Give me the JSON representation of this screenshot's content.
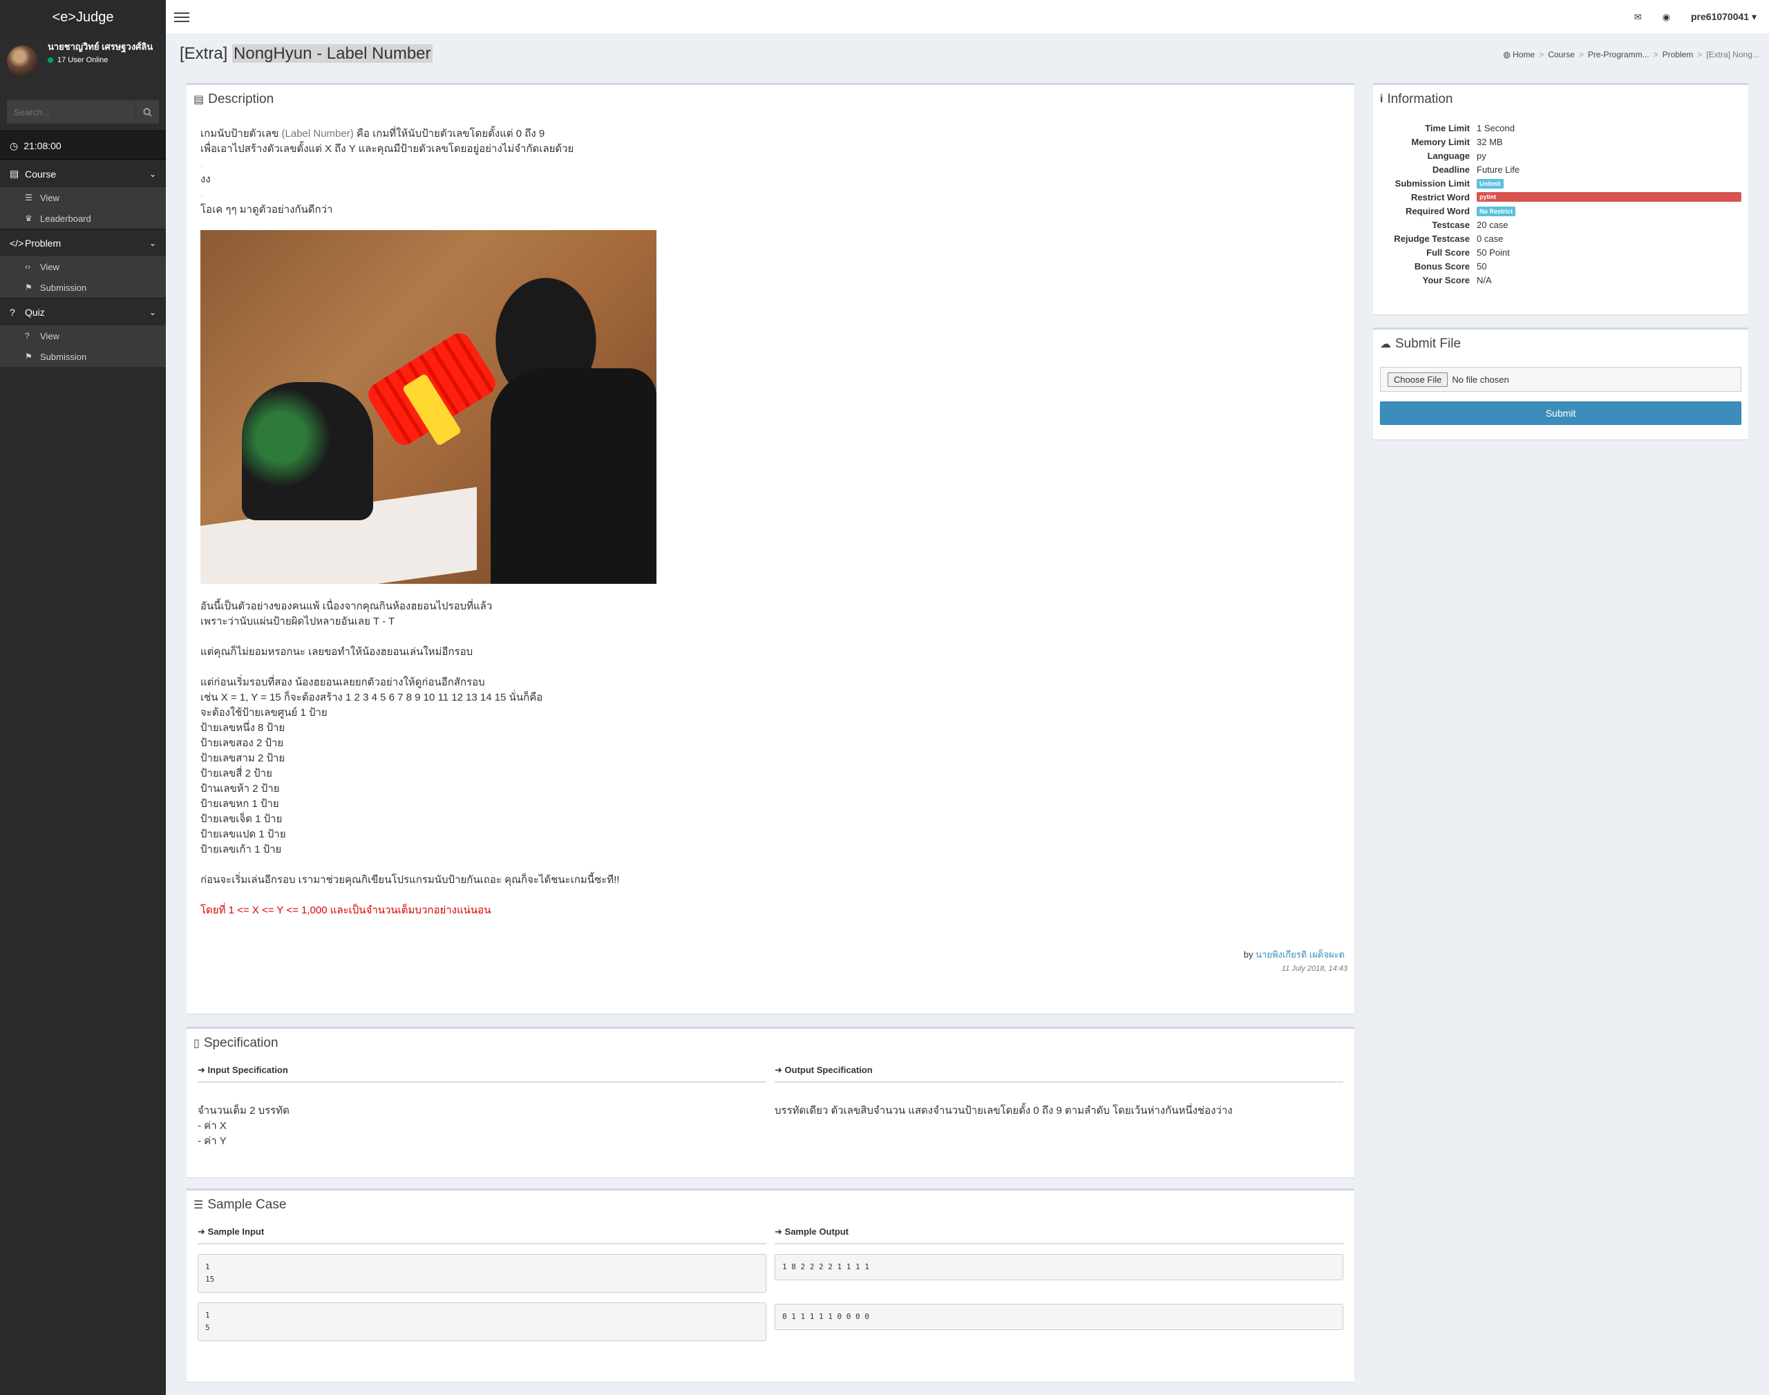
{
  "app": {
    "logo": "<e>Judge"
  },
  "user": {
    "name": "นายชาญวิทย์ เศรษฐวงศ์ลิน",
    "online": "17 User Online",
    "username": "pre61070041"
  },
  "search": {
    "placeholder": "Search..."
  },
  "clock": "21:08:00",
  "sidebar": {
    "sections": [
      {
        "label": "Course",
        "items": [
          {
            "label": "View"
          },
          {
            "label": "Leaderboard"
          }
        ]
      },
      {
        "label": "Problem",
        "items": [
          {
            "label": "View"
          },
          {
            "label": "Submission"
          }
        ]
      },
      {
        "label": "Quiz",
        "items": [
          {
            "label": "View"
          },
          {
            "label": "Submission"
          }
        ]
      }
    ]
  },
  "page": {
    "title_prefix": "[Extra] ",
    "title_main": "NongHyun - Label Number"
  },
  "breadcrumb": [
    "Home",
    "Course",
    "Pre-Programm...",
    "Problem",
    "[Extra] Nong..."
  ],
  "description": {
    "heading": "Description",
    "line1_a": "เกมนับป้ายตัวเลข ",
    "line1_b": "(Label Number)",
    "line1_c": " คือ เกมที่ให้นับป้ายตัวเลขโดยตั้งแต่ 0 ถึง 9",
    "line2": "เพื่อเอาไปสร้างตัวเลขตั้งแต่ X ถึง Y และคุณมีป้ายตัวเลขโดยอยู่อย่างไม่จำกัดเลยด้วย",
    "dot": ".",
    "ngong": "งง",
    "okay": "โอเค ๆๆ มาดูตัวอย่างกันดีกว่า",
    "para1": [
      "อันนี้เป็นตัวอย่างของคนแพ้ เนื่องจากคุณกินห้องฮยอนไปรอบที่แล้ว",
      "เพราะว่านับแผ่นป้ายผิดไปหลายอันเลย  T -  T"
    ],
    "para2": "แต่คุณก็ไม่ยอมหรอกนะ เลยขอทำให้น้องฮยอนเล่นใหม่อีกรอบ",
    "para3": [
      "แต่ก่อนเริ่มรอบที่สอง น้องฮยอนเลยยกตัวอย่างให้ดูก่อนอีกสักรอบ",
      "เช่น X = 1, Y = 15 ก็จะต้องสร้าง 1 2 3 4 5 6 7 8 9 10 11 12 13 14 15 นั่นก็คือ",
      "จะต้องใช้ป้ายเลขศูนย์ 1 ป้าย",
      "ป้ายเลขหนึ่ง 8 ป้าย",
      "ป้ายเลขสอง 2 ป้าย",
      "ป้ายเลขสาม 2 ป้าย",
      "ป้ายเลขสี่ 2 ป้าย",
      "ป้านเลขห้า 2 ป้าย",
      "ป้ายเลขหก 1 ป้าย",
      "ป้ายเลขเจ็ด 1 ป้าย",
      "ป้ายเลขแปด 1 ป้าย",
      "ป้ายเลขเก้า 1 ป้าย"
    ],
    "para4": "ก่อนจะเริ่มเล่นอีกรอบ เรามาช่วยคุณกิเขียนโปรแกรมนับป้ายกันเถอะ คุณก็จะได้ชนะเกมนี้ซะที!!",
    "constraint": "โดยที่ 1 <= X <= Y <= 1,000 และเป็นจำนวนเต็มบวกอย่างแน่นอน",
    "author_prefix": "by ",
    "author": "นายพิงเกียรติ เผด็จผะด",
    "date": "11 July 2018, 14:43"
  },
  "specification": {
    "heading": "Specification",
    "input_head": "Input Specification",
    "output_head": "Output Specification",
    "input_lines": [
      "จำนวนเต็ม 2 บรรทัด",
      "- ค่า X",
      "- ค่า Y"
    ],
    "output_text": "บรรทัดเดียว ตัวเลขสิบจำนวน แสดงจำนวนป้ายเลขโดยตั้ง 0 ถึง 9 ตามลำดับ โดยเว้นห่างกันหนึ่งช่องว่าง"
  },
  "sample": {
    "heading": "Sample Case",
    "input_head": "Sample Input",
    "output_head": "Sample Output",
    "inputs": [
      "1\n15",
      "1\n5"
    ],
    "outputs": [
      "1 8 2 2 2 2 1 1 1 1",
      "0 1 1 1 1 1 0 0 0 0"
    ]
  },
  "information": {
    "heading": "Information",
    "rows": [
      {
        "key": "Time Limit",
        "value": "1 Second"
      },
      {
        "key": "Memory Limit",
        "value": "32 MB"
      },
      {
        "key": "Language",
        "value": "py"
      },
      {
        "key": "Deadline",
        "value": "Future Life"
      },
      {
        "key": "Submission Limit",
        "value": "Unlimit"
      },
      {
        "key": "Restrict Word",
        "value": "pylint"
      },
      {
        "key": "Required Word",
        "value": "No Restrict"
      },
      {
        "key": "Testcase",
        "value": "20 case"
      },
      {
        "key": "Rejudge Testcase",
        "value": "0 case"
      },
      {
        "key": "Full Score",
        "value": "50 Point"
      },
      {
        "key": "Bonus Score",
        "value": "50"
      },
      {
        "key": "Your Score",
        "value": "N/A"
      }
    ]
  },
  "submit": {
    "heading": "Submit File",
    "choose_label": "Choose File",
    "no_file": "No file chosen",
    "button": "Submit"
  },
  "colors": {
    "accent": "#3c8dbc",
    "danger": "#d9534f",
    "info": "#5bc0de",
    "sidebar": "#222d32"
  }
}
